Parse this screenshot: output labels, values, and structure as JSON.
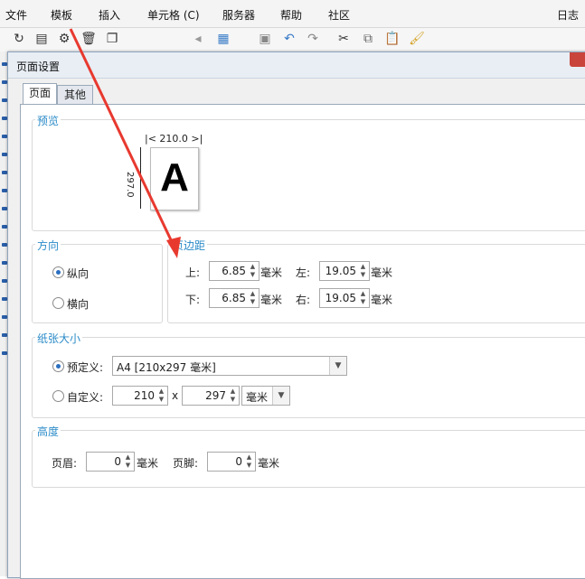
{
  "menu": {
    "file": "文件",
    "template": "模板",
    "insert": "插入",
    "cell": "单元格 (C)",
    "server": "服务器",
    "help": "帮助",
    "community": "社区",
    "log": "日志"
  },
  "dialog": {
    "title": "页面设置",
    "tabs": {
      "page": "页面",
      "other": "其他"
    },
    "preview": {
      "label": "预览",
      "width_dim": "210.0",
      "height_dim": "297.0",
      "letter": "A"
    },
    "orientation": {
      "label": "方向",
      "portrait": "纵向",
      "landscape": "横向",
      "selected": "portrait"
    },
    "margins": {
      "label": "页边距",
      "top_label": "上:",
      "top_value": "6.85",
      "bottom_label": "下:",
      "bottom_value": "6.85",
      "left_label": "左:",
      "left_value": "19.05",
      "right_label": "右:",
      "right_value": "19.05",
      "unit": "毫米"
    },
    "paper": {
      "label": "纸张大小",
      "predefined_label": "预定义:",
      "predefined_value": "A4 [210x297 毫米]",
      "custom_label": "自定义:",
      "custom_width": "210",
      "times": "x",
      "custom_height": "297",
      "custom_unit": "毫米",
      "selected": "predefined"
    },
    "height": {
      "label": "高度",
      "header_label": "页眉:",
      "header_value": "0",
      "footer_label": "页脚:",
      "footer_value": "0",
      "unit": "毫米"
    }
  },
  "colors": {
    "accent_label": "#2b8bc8",
    "annotation_arrow": "#e8392f"
  }
}
